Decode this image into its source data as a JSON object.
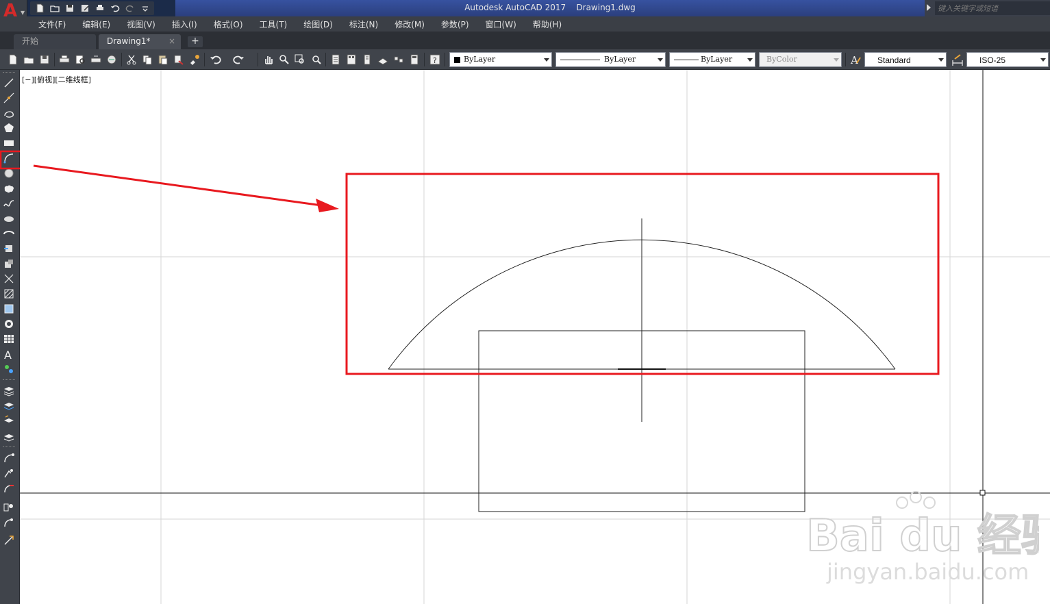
{
  "title": {
    "app": "Autodesk AutoCAD 2017",
    "document": "Drawing1.dwg"
  },
  "search": {
    "placeholder": "键入关键字或短语"
  },
  "quick_access": [
    "new-icon",
    "open-icon",
    "save-icon",
    "save-as-icon",
    "print-icon",
    "undo-icon",
    "redo-icon",
    "customize-icon"
  ],
  "menu": [
    "文件(F)",
    "编辑(E)",
    "视图(V)",
    "插入(I)",
    "格式(O)",
    "工具(T)",
    "绘图(D)",
    "标注(N)",
    "修改(M)",
    "参数(P)",
    "窗口(W)",
    "帮助(H)"
  ],
  "tabs": {
    "start": "开始",
    "drawing": "Drawing1*",
    "close": "×",
    "add": "+"
  },
  "properties": {
    "color": "ByLayer",
    "linetype": "ByLayer",
    "lineweight": "ByLayer",
    "plotstyle": "ByColor",
    "textstyle": "Standard",
    "dimstyle": "ISO-25"
  },
  "viewport": {
    "label": "[−][俯视][二维线框]"
  },
  "left_toolbar": [
    "line-icon",
    "construction-line-icon",
    "polyline-icon",
    "polygon-icon",
    "rectangle-icon",
    "arc-icon",
    "circle-icon",
    "revision-cloud-icon",
    "spline-icon",
    "ellipse-icon",
    "ellipse-arc-icon",
    "insert-block-icon",
    "make-block-icon",
    "point-icon",
    "hatch-icon",
    "gradient-icon",
    "region-icon",
    "table-icon",
    "multiline-text-icon",
    "add-selected-icon",
    "layer-icon",
    "layer-match-icon",
    "layer-prev-icon",
    "layer-iso-icon",
    "modify-arc-icon",
    "modify-point-icon",
    "modify-red-icon",
    "modify-group-icon",
    "modify-trim-icon",
    "modify-extend-icon"
  ],
  "highlight": {
    "annotation_color": "#e8191f",
    "tool": "arc-icon"
  },
  "watermark": {
    "brand": "Bai du 经验",
    "url": "jingyan.baidu.com"
  },
  "colors": {
    "titlebar": "#1b2b49",
    "menubar": "#3b3f46",
    "toolbar": "#40444b",
    "canvas": "#ffffff",
    "annotation": "#e8191f"
  }
}
